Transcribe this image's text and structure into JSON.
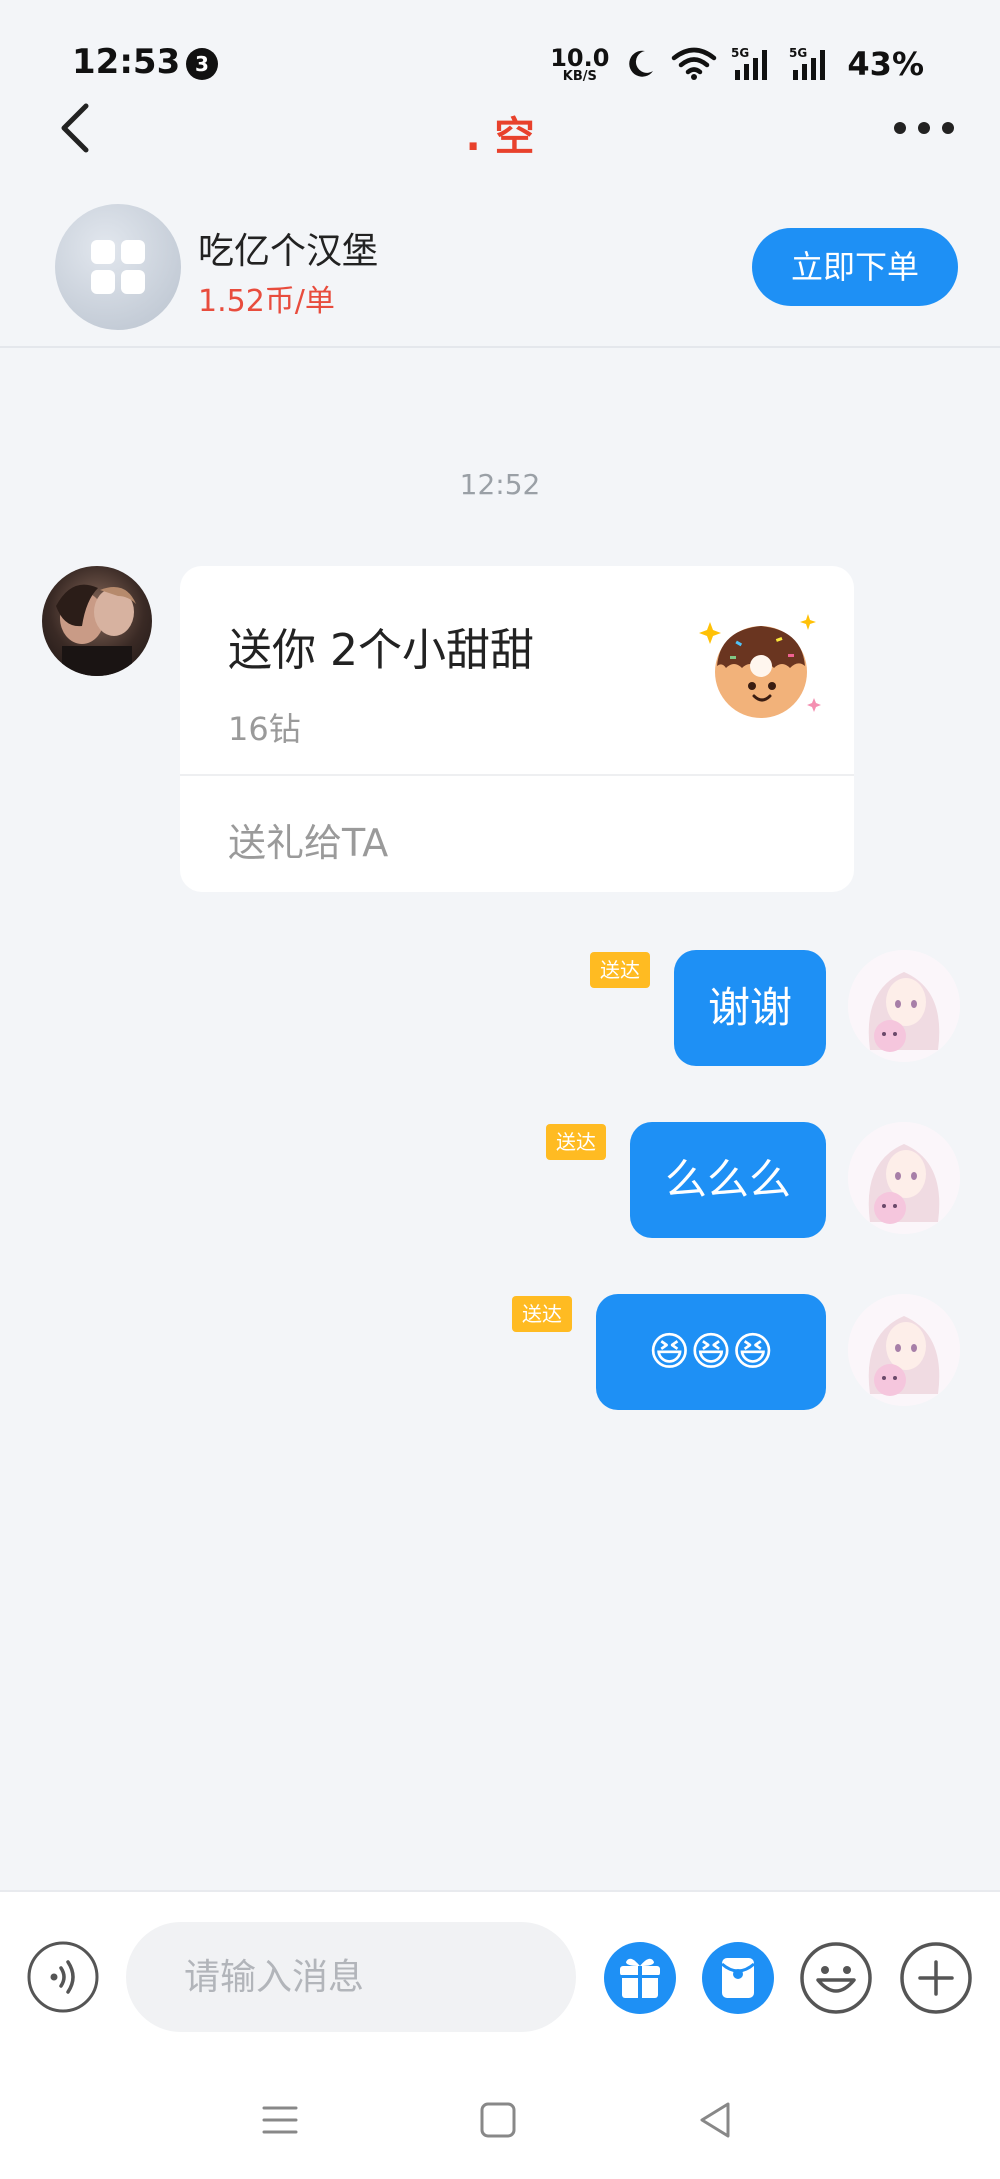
{
  "status_bar": {
    "time": "12:53",
    "notification_count": "3",
    "net_speed_value": "10.0",
    "net_speed_unit": "KB/S",
    "battery": "43%",
    "icons": [
      "moon-icon",
      "wifi-icon",
      "signal-5g-icon",
      "signal-5g-icon"
    ]
  },
  "nav": {
    "title": ". 空",
    "back_icon": "back-chevron-icon",
    "more_icon": "more-dots-icon"
  },
  "product": {
    "name": "吃亿个汉堡",
    "price": "1.52币/单",
    "order_button": "立即下单",
    "avatar_icon": "grid-apps-icon"
  },
  "chat": {
    "timestamp": "12:52",
    "gift_card": {
      "title": "送你 2个小甜甜",
      "price": "16钻",
      "action": "送礼给TA",
      "image": "donut-gift-icon"
    },
    "messages": [
      {
        "text": "谢谢",
        "status": "送达"
      },
      {
        "text": "么么么",
        "status": "送达"
      },
      {
        "text": "😆😆😆",
        "status": "送达"
      }
    ]
  },
  "input_bar": {
    "placeholder": "请输入消息",
    "voice_icon": "voice-icon",
    "tools": [
      "gift-icon",
      "red-packet-icon",
      "emoji-icon",
      "plus-icon"
    ]
  },
  "colors": {
    "accent": "#1e90f5",
    "title_red": "#e8412c",
    "price_red": "#e84c3d",
    "delivered": "#ffbb22",
    "background": "#f3f5f8"
  }
}
